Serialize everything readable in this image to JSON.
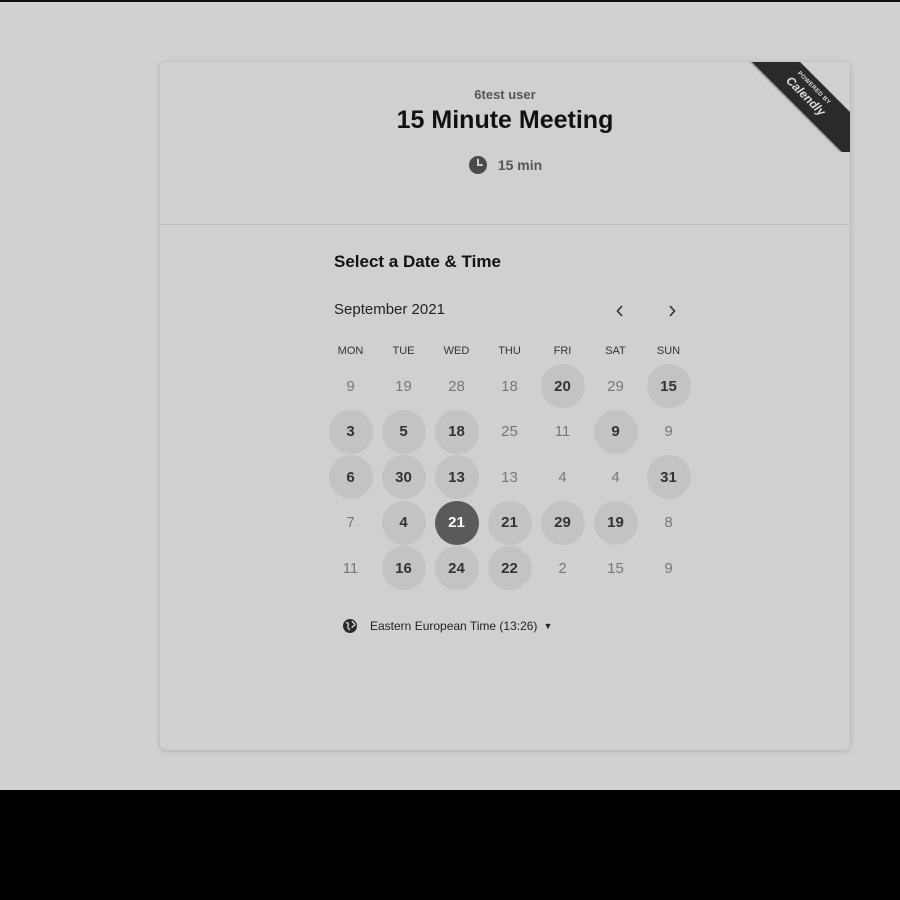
{
  "header": {
    "owner": "6test user",
    "title": "15 Minute Meeting",
    "duration": "15 min"
  },
  "ribbon": {
    "small": "POWERED BY",
    "brand": "Calendly"
  },
  "picker": {
    "title": "Select a Date & Time",
    "month": "September 2021",
    "weekdays": [
      "MON",
      "TUE",
      "WED",
      "THU",
      "FRI",
      "SAT",
      "SUN"
    ],
    "weeks": [
      [
        {
          "d": "9",
          "s": "plain"
        },
        {
          "d": "19",
          "s": "plain"
        },
        {
          "d": "28",
          "s": "plain"
        },
        {
          "d": "18",
          "s": "plain"
        },
        {
          "d": "20",
          "s": "available"
        },
        {
          "d": "29",
          "s": "plain"
        },
        {
          "d": "15",
          "s": "available"
        }
      ],
      [
        {
          "d": "3",
          "s": "available"
        },
        {
          "d": "5",
          "s": "available"
        },
        {
          "d": "18",
          "s": "available"
        },
        {
          "d": "25",
          "s": "plain"
        },
        {
          "d": "11",
          "s": "plain"
        },
        {
          "d": "9",
          "s": "available"
        },
        {
          "d": "9",
          "s": "plain"
        }
      ],
      [
        {
          "d": "6",
          "s": "available"
        },
        {
          "d": "30",
          "s": "available"
        },
        {
          "d": "13",
          "s": "available"
        },
        {
          "d": "13",
          "s": "plain"
        },
        {
          "d": "4",
          "s": "plain"
        },
        {
          "d": "4",
          "s": "plain"
        },
        {
          "d": "31",
          "s": "available"
        }
      ],
      [
        {
          "d": "7",
          "s": "plain"
        },
        {
          "d": "4",
          "s": "available"
        },
        {
          "d": "21",
          "s": "selected"
        },
        {
          "d": "21",
          "s": "available"
        },
        {
          "d": "29",
          "s": "available"
        },
        {
          "d": "19",
          "s": "available"
        },
        {
          "d": "8",
          "s": "plain"
        }
      ],
      [
        {
          "d": "11",
          "s": "plain"
        },
        {
          "d": "16",
          "s": "available"
        },
        {
          "d": "24",
          "s": "available"
        },
        {
          "d": "22",
          "s": "available"
        },
        {
          "d": "2",
          "s": "plain"
        },
        {
          "d": "15",
          "s": "plain"
        },
        {
          "d": "9",
          "s": "plain"
        }
      ]
    ],
    "timezone": "Eastern European Time (13:26)"
  },
  "icons": {
    "clock": "clock-icon",
    "globe": "globe-icon",
    "prev": "chevron-left-icon",
    "next": "chevron-right-icon",
    "caret": "caret-down-icon"
  },
  "colors": {
    "background": "#d1d1d1",
    "card": "#d0d0d0",
    "available_day": "#c3c3c3",
    "selected_day": "#5a5a5a",
    "ribbon": "#2b2b2b"
  }
}
